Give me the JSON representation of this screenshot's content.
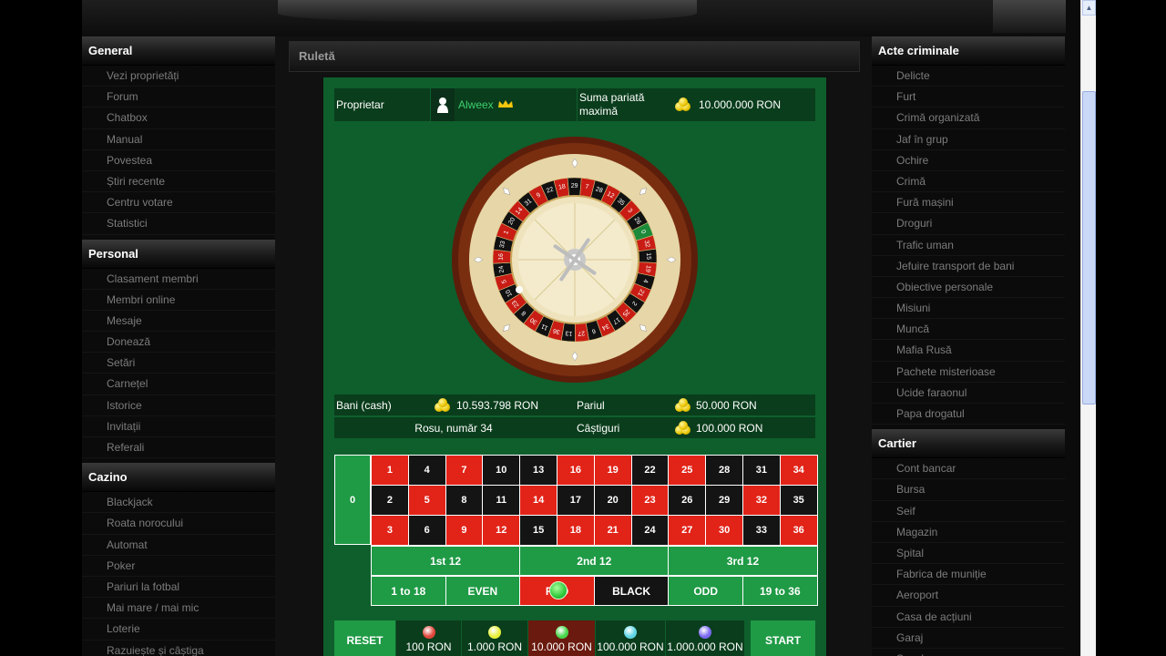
{
  "sidebar_left": [
    {
      "title": "General",
      "items": [
        "Vezi proprietăți",
        "Forum",
        "Chatbox",
        "Manual",
        "Povestea",
        "Știri recente",
        "Centru votare",
        "Statistici"
      ]
    },
    {
      "title": "Personal",
      "items": [
        "Clasament membri",
        "Membri online",
        "Mesaje",
        "Donează",
        "Setări",
        "Carnețel",
        "Istorice",
        "Invitații",
        "Referali"
      ]
    },
    {
      "title": "Cazino",
      "items": [
        "Blackjack",
        "Roata norocului",
        "Automat",
        "Poker",
        "Pariuri la fotbal",
        "Mai mare / mai mic",
        "Loterie",
        "Razuiește și câștiga"
      ]
    }
  ],
  "sidebar_right": [
    {
      "title": "Acte criminale",
      "items": [
        "Delicte",
        "Furt",
        "Crimă organizată",
        "Jaf în grup",
        "Ochire",
        "Crimă",
        "Fură mașini",
        "Droguri",
        "Trafic uman",
        "Jefuire transport de bani",
        "Obiective personale",
        "Misiuni",
        "Muncă",
        "Mafia Rusă",
        "Pachete misterioase",
        "Ucide faraonul",
        "Papa drogatul"
      ]
    },
    {
      "title": "Cartier",
      "items": [
        "Cont bancar",
        "Bursa",
        "Seif",
        "Magazin",
        "Spital",
        "Fabrica de muniție",
        "Aeroport",
        "Casa de acțiuni",
        "Garaj",
        "Școala"
      ]
    }
  ],
  "panel": {
    "title": "Ruletă"
  },
  "owner": {
    "label": "Proprietar",
    "name": "Alweex",
    "max_bet_label": "Suma pariată maximă",
    "max_bet": "10.000.000 RON"
  },
  "wheel": {
    "numbers": [
      "0",
      "32",
      "15",
      "19",
      "4",
      "21",
      "2",
      "25",
      "17",
      "34",
      "6",
      "27",
      "13",
      "36",
      "11",
      "30",
      "8",
      "23",
      "10",
      "5",
      "24",
      "16",
      "33",
      "1",
      "20",
      "14",
      "31",
      "9",
      "22",
      "18",
      "29",
      "7",
      "28",
      "12",
      "35",
      "3",
      "26"
    ]
  },
  "stats": {
    "cash_label": "Bani (cash)",
    "cash": "10.593.798 RON",
    "bet_label": "Pariul",
    "bet": "50.000 RON",
    "result": "Rosu, număr 34",
    "win_label": "Câștiguri",
    "win": "100.000 RON"
  },
  "board": {
    "zero": "0",
    "rows": [
      [
        "3",
        "6",
        "9",
        "12",
        "15",
        "18",
        "21",
        "24",
        "27",
        "30",
        "33",
        "36"
      ],
      [
        "2",
        "5",
        "8",
        "11",
        "14",
        "17",
        "20",
        "23",
        "26",
        "29",
        "32",
        "35"
      ],
      [
        "1",
        "4",
        "7",
        "10",
        "13",
        "16",
        "19",
        "22",
        "25",
        "28",
        "31",
        "34"
      ]
    ],
    "reds": [
      "1",
      "3",
      "5",
      "7",
      "9",
      "12",
      "14",
      "16",
      "18",
      "19",
      "21",
      "23",
      "25",
      "27",
      "30",
      "32",
      "34",
      "36"
    ],
    "dozens": [
      "1st 12",
      "2nd 12",
      "3rd 12"
    ],
    "outside": [
      "1 to 18",
      "EVEN",
      "RED",
      "BLACK",
      "ODD",
      "19 to 36"
    ]
  },
  "chips": [
    {
      "label": "100 RON",
      "color": "#e0463a"
    },
    {
      "label": "1.000 RON",
      "color": "#e8f03a"
    },
    {
      "label": "10.000 RON",
      "color": "#48d64a"
    },
    {
      "label": "100.000 RON",
      "color": "#5fd6e6"
    },
    {
      "label": "1.000.000 RON",
      "color": "#7a68f0"
    }
  ],
  "controls": {
    "reset": "RESET",
    "start": "START"
  },
  "colors": {
    "table_green": "#0e5f2c",
    "cell_green": "#1f9a45",
    "red": "#e22318",
    "black": "#141414",
    "owner_name": "#3ccf6e"
  }
}
